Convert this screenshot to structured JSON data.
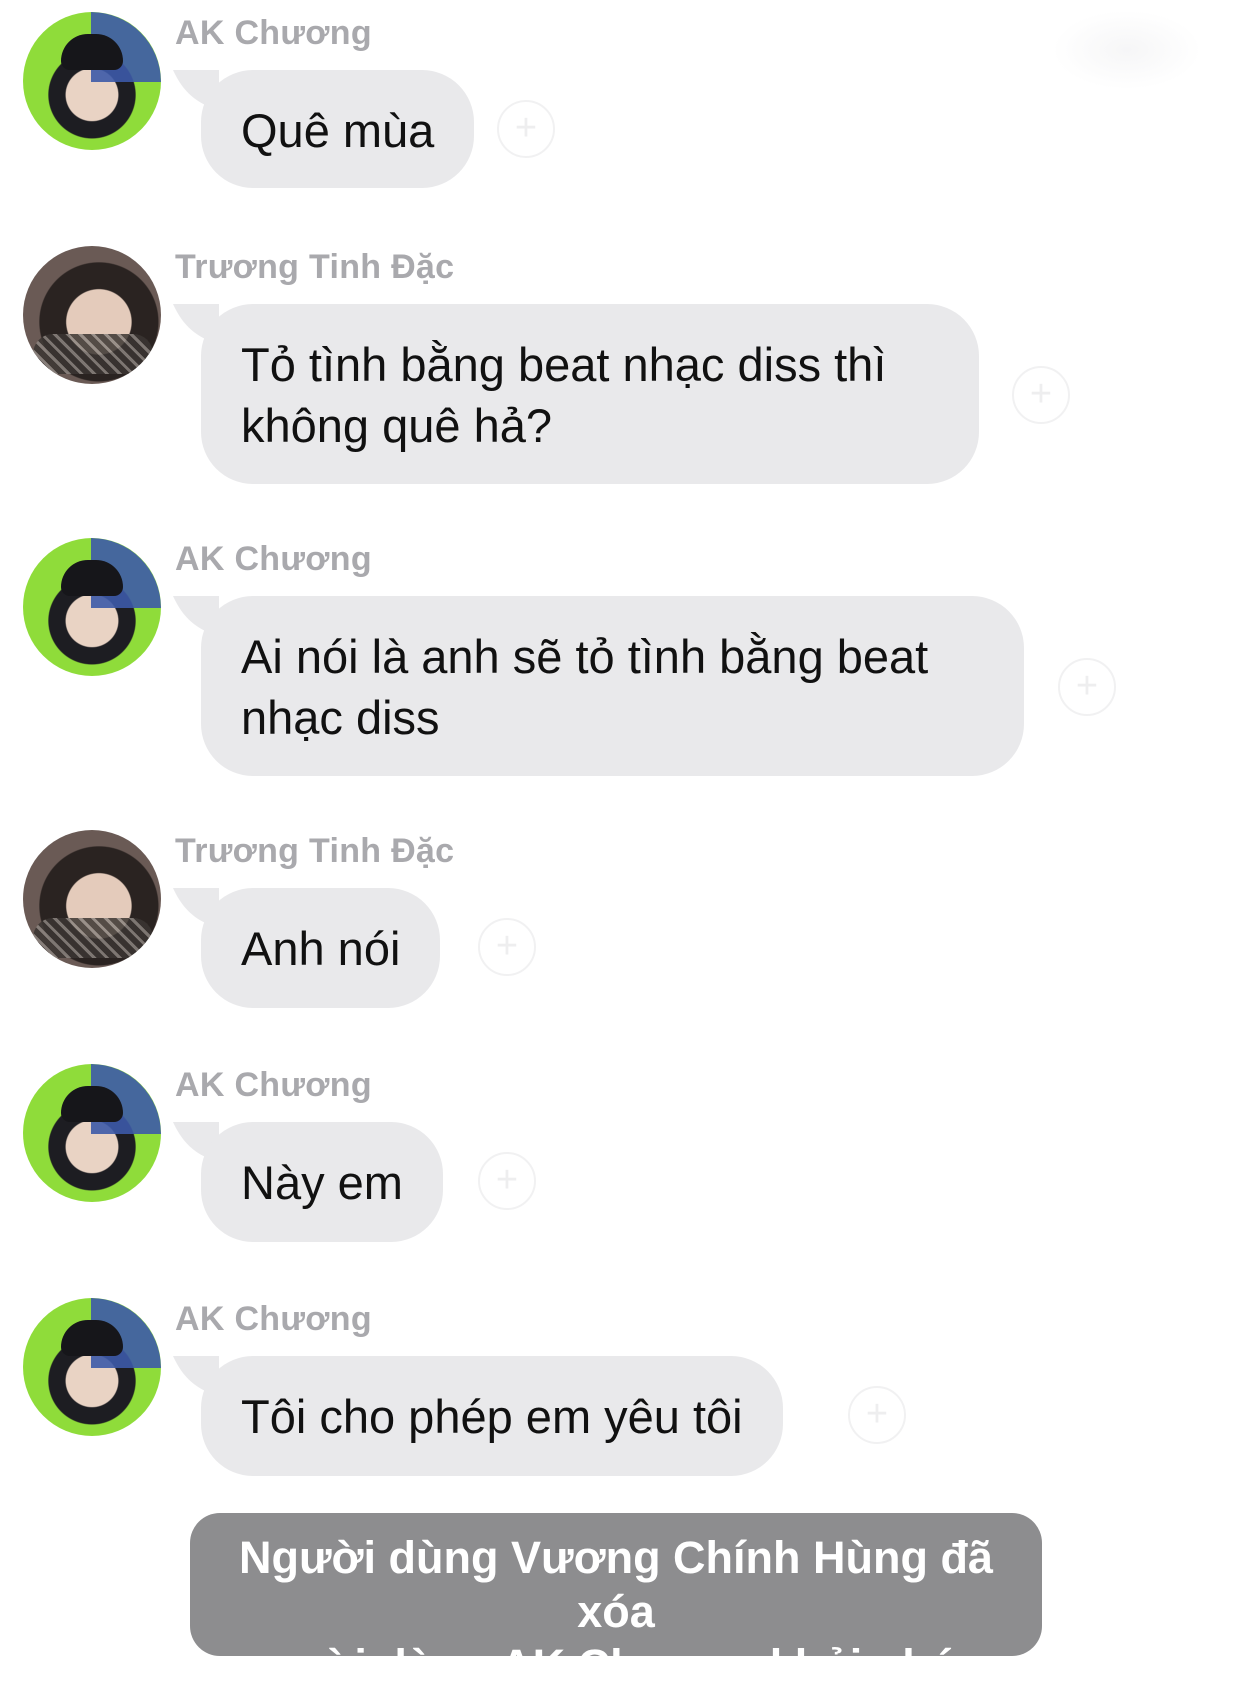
{
  "messages": [
    {
      "sender": "AK Chương",
      "text": "Quê mùa",
      "avatar": "ak-chuong-avatar"
    },
    {
      "sender": "Trương Tinh Đặc",
      "text": "Tỏ tình bằng beat nhạc diss thì\nkhông quê hả?",
      "avatar": "truong-tinh-dac-avatar"
    },
    {
      "sender": "AK Chương",
      "text": "Ai nói là anh sẽ tỏ tình bằng beat\nnhạc diss",
      "avatar": "ak-chuong-avatar"
    },
    {
      "sender": "Trương Tinh Đặc",
      "text": "Anh nói",
      "avatar": "truong-tinh-dac-avatar"
    },
    {
      "sender": "AK Chương",
      "text": "Này em",
      "avatar": "ak-chuong-avatar"
    },
    {
      "sender": "AK Chương",
      "text": "Tôi cho phép em yêu tôi",
      "avatar": "ak-chuong-avatar"
    }
  ],
  "system_notice": "Người dùng Vương Chính Hùng đã xóa\nngười dùng AK Chương khỏi nhóm",
  "reaction_icon": "+",
  "colors": {
    "bubble": "#e9e9eb",
    "name": "#a9a9ad",
    "notice_bg": "#8d8d8f"
  }
}
